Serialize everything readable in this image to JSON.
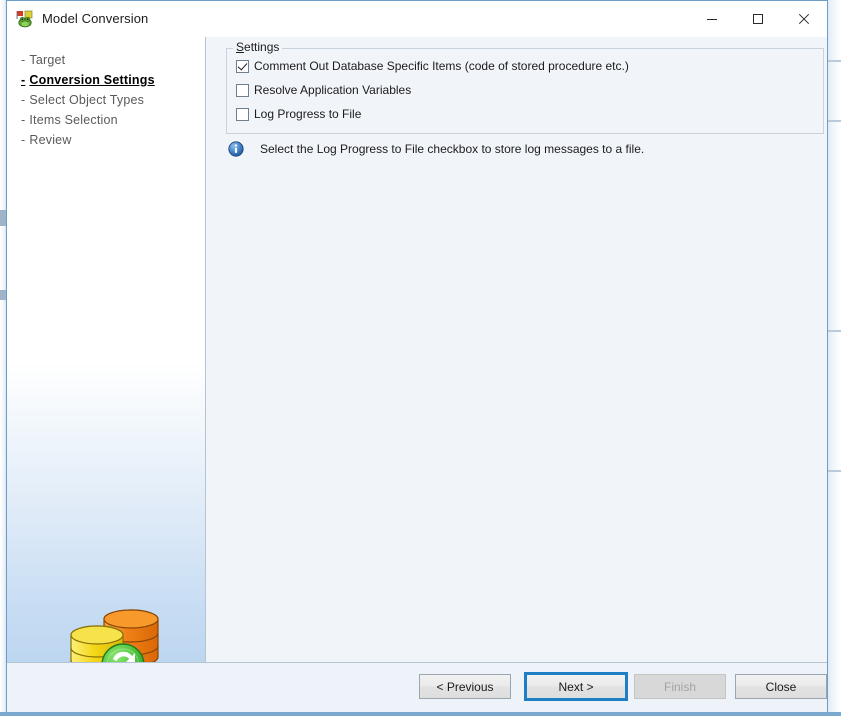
{
  "window": {
    "title": "Model Conversion",
    "app_icon": "frog-flag-icon",
    "controls": {
      "minimize": "minimize-icon",
      "maximize": "maximize-icon",
      "close": "close-icon"
    }
  },
  "sidebar": {
    "graphic": "database-sync-icon",
    "items": [
      {
        "label": "Target",
        "active": false
      },
      {
        "label": "Conversion Settings",
        "active": true
      },
      {
        "label": "Select Object Types",
        "active": false
      },
      {
        "label": "Items Selection",
        "active": false
      },
      {
        "label": "Review",
        "active": false
      }
    ]
  },
  "main": {
    "group": {
      "legend_first": "S",
      "legend_rest": "ettings"
    },
    "checkboxes": [
      {
        "label": "Comment Out Database Specific Items (code of stored procedure etc.)",
        "checked": true
      },
      {
        "label": "Resolve Application Variables",
        "checked": false
      },
      {
        "label": "Log Progress to File",
        "checked": false
      }
    ],
    "info": {
      "icon": "info-icon",
      "text": "Select the Log Progress to File checkbox to store log messages to a file."
    }
  },
  "footer": {
    "previous": "< Previous",
    "next": "Next >",
    "finish": "Finish",
    "close": "Close"
  },
  "colors": {
    "accent": "#1f7fc4",
    "panel": "#f1f5f9",
    "sidebar_bottom": "#bdd6f0",
    "window_border": "#6a9ec9",
    "info_blue": "#2f6fb5"
  }
}
